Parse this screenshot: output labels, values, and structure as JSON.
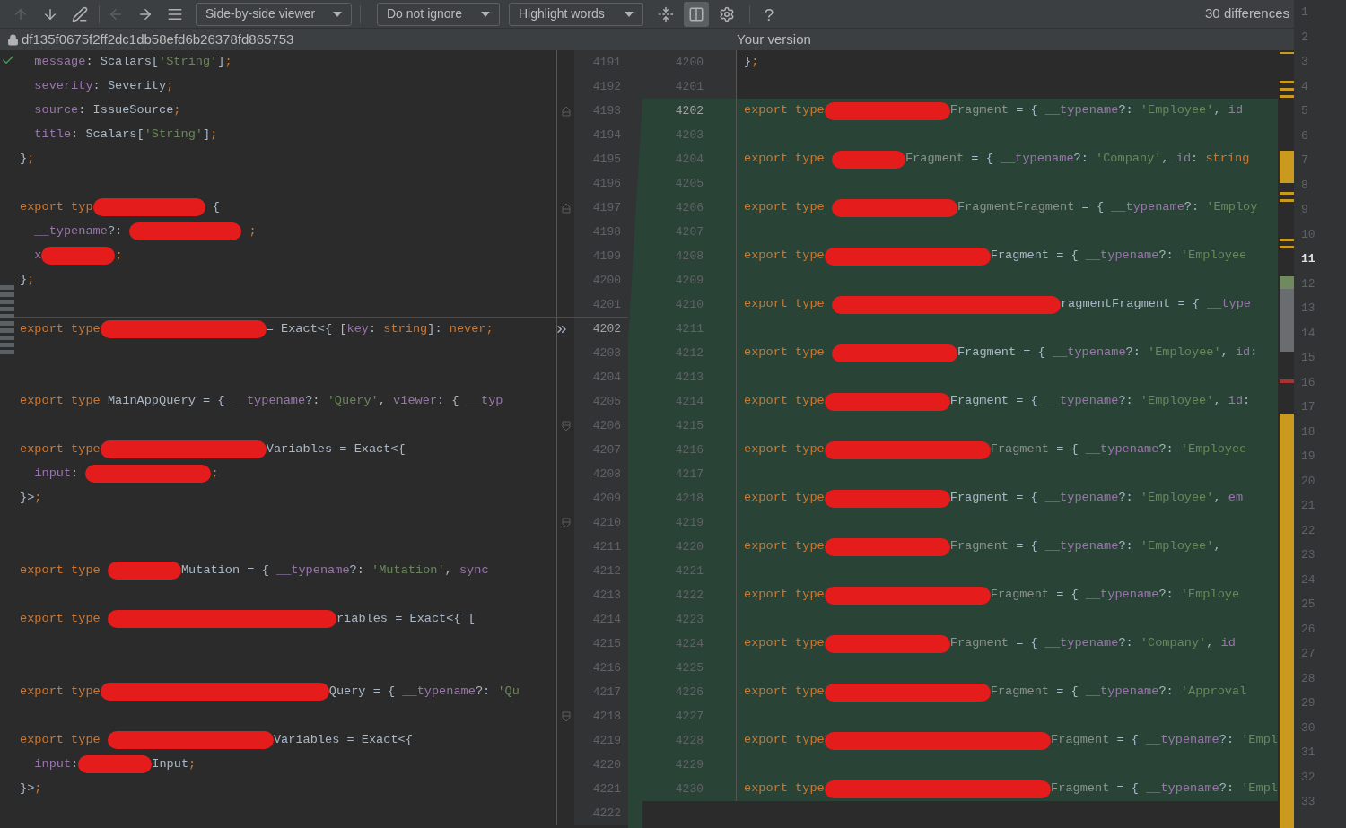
{
  "toolbar": {
    "nav_buttons": [
      {
        "kind": "arrow-up",
        "disabled": true
      },
      {
        "kind": "arrow-down",
        "disabled": false
      },
      {
        "kind": "edit",
        "disabled": false
      },
      {
        "kind": "arrow-left",
        "disabled": true
      },
      {
        "kind": "arrow-right",
        "disabled": false
      },
      {
        "kind": "list",
        "disabled": false
      }
    ],
    "dropdowns": [
      {
        "label": "Side-by-side viewer"
      },
      {
        "label": "Do not ignore"
      },
      {
        "label": "Highlight words"
      }
    ],
    "view_buttons": [
      {
        "kind": "collapse",
        "selected": false
      },
      {
        "kind": "columns",
        "selected": true
      },
      {
        "kind": "settings",
        "selected": false
      }
    ],
    "help": "?",
    "differences": "30 differences"
  },
  "header": {
    "left_title": "df135f0675f2ff2dc1db58efd6b26378fd865753",
    "right_title": "Your version"
  },
  "left_pane": {
    "lines": [
      {
        "number": "4191",
        "current": false,
        "tokens": [
          {
            "kind": "prop",
            "text": "  message"
          },
          {
            "kind": "id",
            "text": ": Scalars["
          },
          {
            "kind": "str",
            "text": "'String'"
          },
          {
            "kind": "id",
            "text": "]"
          },
          {
            "kind": "semi",
            "text": ";"
          }
        ]
      },
      {
        "number": "4192",
        "current": false,
        "tokens": [
          {
            "kind": "prop",
            "text": "  severity"
          },
          {
            "kind": "id",
            "text": ": Severity"
          },
          {
            "kind": "semi",
            "text": ";"
          }
        ]
      },
      {
        "number": "4193",
        "current": false,
        "kind": "fold-end",
        "tokens": [
          {
            "kind": "prop",
            "text": "  source"
          },
          {
            "kind": "id",
            "text": ": IssueSource"
          },
          {
            "kind": "semi",
            "text": ";"
          }
        ]
      },
      {
        "number": "4194",
        "current": false,
        "tokens": [
          {
            "kind": "prop",
            "text": "  title"
          },
          {
            "kind": "id",
            "text": ": Scalars["
          },
          {
            "kind": "str",
            "text": "'String'"
          },
          {
            "kind": "id",
            "text": "]"
          },
          {
            "kind": "semi",
            "text": ";"
          }
        ]
      },
      {
        "number": "4195",
        "current": false,
        "tokens": [
          {
            "kind": "id",
            "text": "}"
          },
          {
            "kind": "semi",
            "text": ";"
          }
        ]
      },
      {
        "number": "4196",
        "current": false
      },
      {
        "number": "4197",
        "current": false,
        "kind": "fold-end",
        "tokens": [
          {
            "kind": "kw",
            "text": "export typ"
          },
          {
            "kind": "redaction-medium"
          },
          {
            "kind": "id",
            "text": " {"
          }
        ]
      },
      {
        "number": "4198",
        "current": false,
        "tokens": [
          {
            "kind": "prop",
            "text": "  __typename"
          },
          {
            "kind": "id",
            "text": "?: "
          },
          {
            "kind": "redaction-medium"
          },
          {
            "kind": "semi",
            "text": " ;"
          }
        ]
      },
      {
        "number": "4199",
        "current": false,
        "tokens": [
          {
            "kind": "prop",
            "text": "  x"
          },
          {
            "kind": "redaction-short"
          },
          {
            "kind": "semi",
            "text": ";"
          }
        ]
      },
      {
        "number": "4200",
        "current": false,
        "tokens": [
          {
            "kind": "id",
            "text": "}"
          },
          {
            "kind": "semi",
            "text": ";"
          }
        ]
      },
      {
        "number": "4201",
        "current": false
      },
      {
        "number": "4202",
        "current": true,
        "tokens": [
          {
            "kind": "kw",
            "text": "export type"
          },
          {
            "kind": "redaction-xlong"
          },
          {
            "kind": "id",
            "text": "= Exact<{ ["
          },
          {
            "kind": "prop",
            "text": "key"
          },
          {
            "kind": "id",
            "text": ": "
          },
          {
            "kind": "kw",
            "text": "string"
          },
          {
            "kind": "id",
            "text": "]: "
          },
          {
            "kind": "kw",
            "text": "never;"
          }
        ]
      },
      {
        "number": "4203",
        "current": false
      },
      {
        "number": "4204",
        "current": false
      },
      {
        "number": "4205",
        "current": false,
        "tokens": [
          {
            "kind": "kw",
            "text": "export type "
          },
          {
            "kind": "id",
            "text": "MainAppQuery = { "
          },
          {
            "kind": "prop",
            "text": "__typename"
          },
          {
            "kind": "id",
            "text": "?: "
          },
          {
            "kind": "str",
            "text": "'Query'"
          },
          {
            "kind": "id",
            "text": ", "
          },
          {
            "kind": "prop",
            "text": "viewer"
          },
          {
            "kind": "id",
            "text": ": { "
          },
          {
            "kind": "prop",
            "text": "__typ"
          }
        ]
      },
      {
        "number": "4206",
        "current": false,
        "kind": "fold-start"
      },
      {
        "number": "4207",
        "current": false,
        "tokens": [
          {
            "kind": "kw",
            "text": "export type"
          },
          {
            "kind": "redaction-xlong"
          },
          {
            "kind": "id",
            "text": "Variables = Exact<{"
          }
        ]
      },
      {
        "number": "4208",
        "current": false,
        "tokens": [
          {
            "kind": "prop",
            "text": "  input"
          },
          {
            "kind": "id",
            "text": ": "
          },
          {
            "kind": "redaction-long"
          },
          {
            "kind": "semi",
            "text": ";"
          }
        ]
      },
      {
        "number": "4209",
        "current": false,
        "tokens": [
          {
            "kind": "id",
            "text": "}>"
          },
          {
            "kind": "semi",
            "text": ";"
          }
        ]
      },
      {
        "number": "4210",
        "current": false,
        "kind": "fold-start"
      },
      {
        "number": "4211",
        "current": false
      },
      {
        "number": "4212",
        "current": false,
        "tokens": [
          {
            "kind": "kw",
            "text": "export type "
          },
          {
            "kind": "redaction-short"
          },
          {
            "kind": "id",
            "text": "Mutation = { "
          },
          {
            "kind": "prop",
            "text": "__typename"
          },
          {
            "kind": "id",
            "text": "?: "
          },
          {
            "kind": "str",
            "text": "'Mutation'"
          },
          {
            "kind": "id",
            "text": ", "
          },
          {
            "kind": "prop",
            "text": "sync"
          }
        ]
      },
      {
        "number": "4213",
        "current": false
      },
      {
        "number": "4214",
        "current": false,
        "tokens": [
          {
            "kind": "kw",
            "text": "export type "
          },
          {
            "kind": "redaction-xxlong"
          },
          {
            "kind": "id",
            "text": "riables = Exact<{ ["
          }
        ]
      },
      {
        "number": "4215",
        "current": false
      },
      {
        "number": "4216",
        "current": false
      },
      {
        "number": "4217",
        "current": false,
        "tokens": [
          {
            "kind": "kw",
            "text": "export type"
          },
          {
            "kind": "redaction-xxlong"
          },
          {
            "kind": "id",
            "text": "Query = { "
          },
          {
            "kind": "prop",
            "text": "__typename"
          },
          {
            "kind": "id",
            "text": "?: "
          },
          {
            "kind": "str",
            "text": "'Qu"
          }
        ]
      },
      {
        "number": "4218",
        "current": false,
        "kind": "fold-start"
      },
      {
        "number": "4219",
        "current": false,
        "tokens": [
          {
            "kind": "kw",
            "text": "export type "
          },
          {
            "kind": "redaction-xlong"
          },
          {
            "kind": "id",
            "text": "Variables = Exact<{"
          }
        ]
      },
      {
        "number": "4220",
        "current": false,
        "tokens": [
          {
            "kind": "prop",
            "text": "  input"
          },
          {
            "kind": "id",
            "text": ":"
          },
          {
            "kind": "redaction-short"
          },
          {
            "kind": "id",
            "text": "Input"
          },
          {
            "kind": "semi",
            "text": ";"
          }
        ]
      },
      {
        "number": "4221",
        "current": false,
        "tokens": [
          {
            "kind": "id",
            "text": "}>"
          },
          {
            "kind": "semi",
            "text": ";"
          }
        ]
      },
      {
        "number": "4222",
        "current": false
      }
    ]
  },
  "right_pane": {
    "lines": [
      {
        "number": "4200",
        "current": false,
        "changed": false,
        "tokens": [
          {
            "kind": "id",
            "text": "}"
          },
          {
            "kind": "semi",
            "text": ";"
          }
        ]
      },
      {
        "number": "4201",
        "current": false,
        "changed": false
      },
      {
        "number": "4202",
        "current": true,
        "changed": true,
        "tokens": [
          {
            "kind": "kw",
            "text": "export type"
          },
          {
            "kind": "redaction-long"
          },
          {
            "kind": "dim",
            "text": "Fragment"
          },
          {
            "kind": "id",
            "text": " = { "
          },
          {
            "kind": "prop",
            "text": "__typename"
          },
          {
            "kind": "id",
            "text": "?: "
          },
          {
            "kind": "str",
            "text": "'Employee'"
          },
          {
            "kind": "id",
            "text": ", "
          },
          {
            "kind": "prop",
            "text": "id"
          }
        ]
      },
      {
        "number": "4203",
        "current": false,
        "changed": true
      },
      {
        "number": "4204",
        "current": false,
        "changed": true,
        "tokens": [
          {
            "kind": "kw",
            "text": "export type "
          },
          {
            "kind": "redaction-short"
          },
          {
            "kind": "dim",
            "text": "Fragment"
          },
          {
            "kind": "id",
            "text": " = { "
          },
          {
            "kind": "prop",
            "text": "__typename"
          },
          {
            "kind": "id",
            "text": "?: "
          },
          {
            "kind": "str",
            "text": "'Company'"
          },
          {
            "kind": "id",
            "text": ", "
          },
          {
            "kind": "prop",
            "text": "id"
          },
          {
            "kind": "id",
            "text": ": "
          },
          {
            "kind": "kw",
            "text": "string"
          }
        ]
      },
      {
        "number": "4205",
        "current": false,
        "changed": true
      },
      {
        "number": "4206",
        "current": false,
        "changed": true,
        "tokens": [
          {
            "kind": "kw",
            "text": "export type "
          },
          {
            "kind": "redaction-long"
          },
          {
            "kind": "dim",
            "text": "FragmentFragment"
          },
          {
            "kind": "id",
            "text": " = { "
          },
          {
            "kind": "prop",
            "text": "__typename"
          },
          {
            "kind": "id",
            "text": "?: "
          },
          {
            "kind": "str",
            "text": "'Employ"
          }
        ]
      },
      {
        "number": "4207",
        "current": false,
        "changed": true
      },
      {
        "number": "4208",
        "current": false,
        "changed": true,
        "tokens": [
          {
            "kind": "kw",
            "text": "export type"
          },
          {
            "kind": "redaction-xlong"
          },
          {
            "kind": "id",
            "text": "Fragment = { "
          },
          {
            "kind": "prop",
            "text": "__typename"
          },
          {
            "kind": "id",
            "text": "?: "
          },
          {
            "kind": "str",
            "text": "'Employee"
          }
        ]
      },
      {
        "number": "4209",
        "current": false,
        "changed": true
      },
      {
        "number": "4210",
        "current": false,
        "changed": true,
        "tokens": [
          {
            "kind": "kw",
            "text": "export type "
          },
          {
            "kind": "redaction-xxlong"
          },
          {
            "kind": "id",
            "text": "ragmentFragment = { "
          },
          {
            "kind": "prop",
            "text": "__type"
          }
        ]
      },
      {
        "number": "4211",
        "current": false,
        "changed": true
      },
      {
        "number": "4212",
        "current": false,
        "changed": true,
        "tokens": [
          {
            "kind": "kw",
            "text": "export type "
          },
          {
            "kind": "redaction-long"
          },
          {
            "kind": "id",
            "text": "Fragment = { "
          },
          {
            "kind": "prop",
            "text": "__typename"
          },
          {
            "kind": "id",
            "text": "?: "
          },
          {
            "kind": "str",
            "text": "'Employee'"
          },
          {
            "kind": "id",
            "text": ", "
          },
          {
            "kind": "prop",
            "text": "id"
          },
          {
            "kind": "id",
            "text": ":"
          }
        ]
      },
      {
        "number": "4213",
        "current": false,
        "changed": true
      },
      {
        "number": "4214",
        "current": false,
        "changed": true,
        "tokens": [
          {
            "kind": "kw",
            "text": "export type"
          },
          {
            "kind": "redaction-long"
          },
          {
            "kind": "id",
            "text": "Fragment = { "
          },
          {
            "kind": "prop",
            "text": "__typename"
          },
          {
            "kind": "id",
            "text": "?: "
          },
          {
            "kind": "str",
            "text": "'Employee'"
          },
          {
            "kind": "id",
            "text": ", "
          },
          {
            "kind": "prop",
            "text": "id"
          },
          {
            "kind": "id",
            "text": ":"
          }
        ]
      },
      {
        "number": "4215",
        "current": false,
        "changed": true
      },
      {
        "number": "4216",
        "current": false,
        "changed": true,
        "tokens": [
          {
            "kind": "kw",
            "text": "export type"
          },
          {
            "kind": "redaction-xlong"
          },
          {
            "kind": "dim",
            "text": "Fragment"
          },
          {
            "kind": "id",
            "text": " = { "
          },
          {
            "kind": "prop",
            "text": "__typename"
          },
          {
            "kind": "id",
            "text": "?: "
          },
          {
            "kind": "str",
            "text": "'Employee"
          }
        ]
      },
      {
        "number": "4217",
        "current": false,
        "changed": true
      },
      {
        "number": "4218",
        "current": false,
        "changed": true,
        "tokens": [
          {
            "kind": "kw",
            "text": "export type"
          },
          {
            "kind": "redaction-long"
          },
          {
            "kind": "id",
            "text": "Fragment = { "
          },
          {
            "kind": "prop",
            "text": "__typename"
          },
          {
            "kind": "id",
            "text": "?: "
          },
          {
            "kind": "str",
            "text": "'Employee'"
          },
          {
            "kind": "id",
            "text": ", "
          },
          {
            "kind": "prop",
            "text": "em"
          }
        ]
      },
      {
        "number": "4219",
        "current": false,
        "changed": true
      },
      {
        "number": "4220",
        "current": false,
        "changed": true,
        "tokens": [
          {
            "kind": "kw",
            "text": "export type"
          },
          {
            "kind": "redaction-long"
          },
          {
            "kind": "dim",
            "text": "Fragment"
          },
          {
            "kind": "id",
            "text": " = { "
          },
          {
            "kind": "prop",
            "text": "__typename"
          },
          {
            "kind": "id",
            "text": "?: "
          },
          {
            "kind": "str",
            "text": "'Employee'"
          },
          {
            "kind": "id",
            "text": ","
          }
        ]
      },
      {
        "number": "4221",
        "current": false,
        "changed": true
      },
      {
        "number": "4222",
        "current": false,
        "changed": true,
        "tokens": [
          {
            "kind": "kw",
            "text": "export type"
          },
          {
            "kind": "redaction-xlong"
          },
          {
            "kind": "dim",
            "text": "Fragment"
          },
          {
            "kind": "id",
            "text": " = { "
          },
          {
            "kind": "prop",
            "text": "__typename"
          },
          {
            "kind": "id",
            "text": "?: "
          },
          {
            "kind": "str",
            "text": "'Employe"
          }
        ]
      },
      {
        "number": "4223",
        "current": false,
        "changed": true
      },
      {
        "number": "4224",
        "current": false,
        "changed": true,
        "tokens": [
          {
            "kind": "kw",
            "text": "export type"
          },
          {
            "kind": "redaction-long"
          },
          {
            "kind": "dim",
            "text": "Fragment"
          },
          {
            "kind": "id",
            "text": " = { "
          },
          {
            "kind": "prop",
            "text": "__typename"
          },
          {
            "kind": "id",
            "text": "?: "
          },
          {
            "kind": "str",
            "text": "'Company'"
          },
          {
            "kind": "id",
            "text": ", "
          },
          {
            "kind": "prop",
            "text": "id"
          }
        ]
      },
      {
        "number": "4225",
        "current": false,
        "changed": true
      },
      {
        "number": "4226",
        "current": false,
        "changed": true,
        "tokens": [
          {
            "kind": "kw",
            "text": "export type"
          },
          {
            "kind": "redaction-xlong"
          },
          {
            "kind": "dim",
            "text": "Fragment"
          },
          {
            "kind": "id",
            "text": " = { "
          },
          {
            "kind": "prop",
            "text": "__typename"
          },
          {
            "kind": "id",
            "text": "?: "
          },
          {
            "kind": "str",
            "text": "'Approval"
          }
        ]
      },
      {
        "number": "4227",
        "current": false,
        "changed": true
      },
      {
        "number": "4228",
        "current": false,
        "changed": true,
        "tokens": [
          {
            "kind": "kw",
            "text": "export type"
          },
          {
            "kind": "redaction-xxlong"
          },
          {
            "kind": "dim",
            "text": "Fragment"
          },
          {
            "kind": "id",
            "text": " = { "
          },
          {
            "kind": "prop",
            "text": "__typename"
          },
          {
            "kind": "id",
            "text": "?: "
          },
          {
            "kind": "str",
            "text": "'Empl"
          }
        ]
      },
      {
        "number": "4229",
        "current": false,
        "changed": true
      },
      {
        "number": "4230",
        "current": false,
        "changed": true,
        "tokens": [
          {
            "kind": "kw",
            "text": "export type"
          },
          {
            "kind": "redaction-xxlong"
          },
          {
            "kind": "dim",
            "text": "Fragment"
          },
          {
            "kind": "id",
            "text": " = { "
          },
          {
            "kind": "prop",
            "text": "__typename"
          },
          {
            "kind": "id",
            "text": "?: "
          },
          {
            "kind": "str",
            "text": "'Empl"
          }
        ]
      }
    ]
  },
  "line_strip": [
    {
      "text": "1",
      "selected": false
    },
    {
      "text": "2",
      "selected": false
    },
    {
      "text": "3",
      "selected": false
    },
    {
      "text": "4",
      "selected": false
    },
    {
      "text": "5",
      "selected": false
    },
    {
      "text": "6",
      "selected": false
    },
    {
      "text": "7",
      "selected": false
    },
    {
      "text": "8",
      "selected": false
    },
    {
      "text": "9",
      "selected": false
    },
    {
      "text": "10",
      "selected": false
    },
    {
      "text": "11",
      "selected": true
    },
    {
      "text": "12",
      "selected": false
    },
    {
      "text": "13",
      "selected": false
    },
    {
      "text": "14",
      "selected": false
    },
    {
      "text": "15",
      "selected": false
    },
    {
      "text": "16",
      "selected": false
    },
    {
      "text": "17",
      "selected": false
    },
    {
      "text": "18",
      "selected": false
    },
    {
      "text": "19",
      "selected": false
    },
    {
      "text": "20",
      "selected": false
    },
    {
      "text": "21",
      "selected": false
    },
    {
      "text": "22",
      "selected": false
    },
    {
      "text": "23",
      "selected": false
    },
    {
      "text": "24",
      "selected": false
    },
    {
      "text": "25",
      "selected": false
    },
    {
      "text": "26",
      "selected": false
    },
    {
      "text": "27",
      "selected": false
    },
    {
      "text": "28",
      "selected": false
    },
    {
      "text": "29",
      "selected": false
    },
    {
      "text": "30",
      "selected": false
    },
    {
      "text": "31",
      "selected": false
    },
    {
      "text": "32",
      "selected": false
    },
    {
      "text": "33",
      "selected": false
    }
  ]
}
